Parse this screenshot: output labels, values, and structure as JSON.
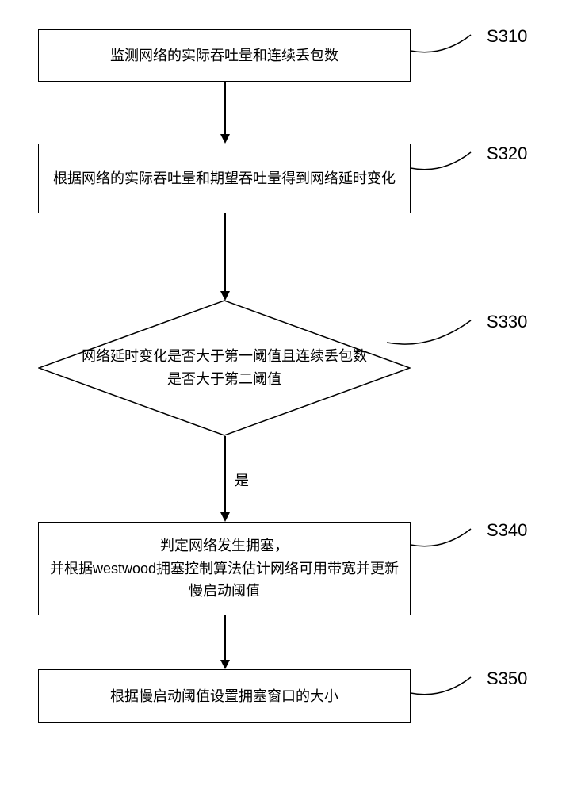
{
  "steps": {
    "s310": {
      "label": "S310",
      "text": "监测网络的实际吞吐量和连续丢包数"
    },
    "s320": {
      "label": "S320",
      "text": "根据网络的实际吞吐量和期望吞吐量得到网络延时变化"
    },
    "s330": {
      "label": "S330",
      "text": "网络延时变化是否大于第一阈值且连续丢包数是否大于第二阈值"
    },
    "s340": {
      "label": "S340",
      "text": "判定网络发生拥塞，\n并根据westwood拥塞控制算法估计网络可用带宽并更新慢启动阈值"
    },
    "s350": {
      "label": "S350",
      "text": "根据慢启动阈值设置拥塞窗口的大小"
    }
  },
  "branch": {
    "yes": "是"
  }
}
